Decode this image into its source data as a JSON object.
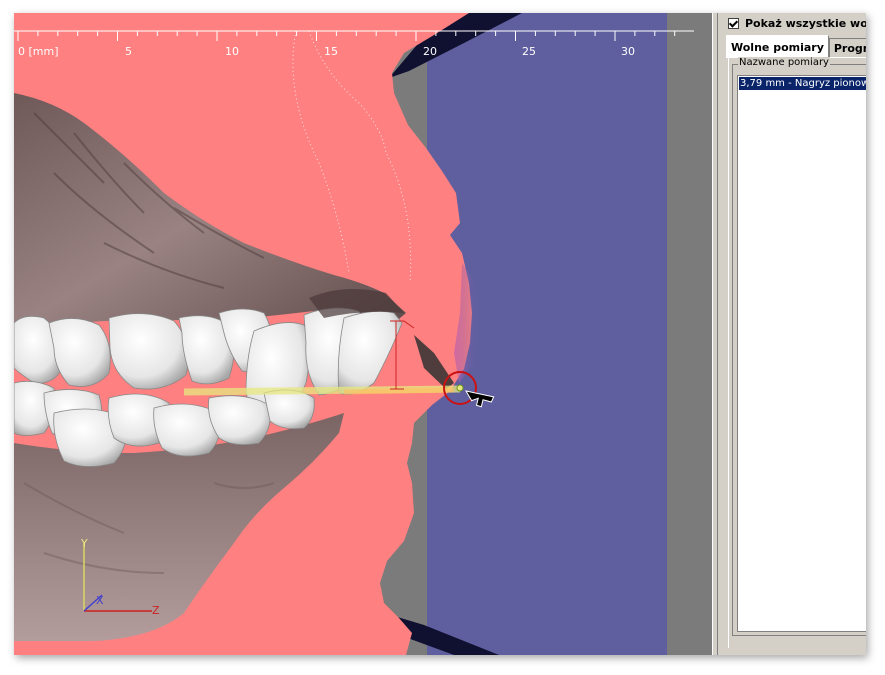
{
  "viewport": {
    "ruler": {
      "unit_label": "0 [mm]",
      "ticks": [
        "5",
        "10",
        "15",
        "20",
        "25",
        "30"
      ]
    },
    "axes": {
      "y": "Y",
      "x": "X",
      "z": "Z"
    },
    "colors": {
      "soft_tissue_plane": "#ff8080",
      "measurement_plane": "#5f5fa0",
      "background": "#7b7b7b",
      "gum": "#8a7272",
      "teeth": "#f2f2f2",
      "measure_line": "#e8e880",
      "vertical_marker": "#cc2222"
    }
  },
  "sidepanel": {
    "show_all_checkbox": {
      "label": "Pokaż wszystkie wolne",
      "checked": true
    },
    "tabs": [
      {
        "label": "Wolne pomiary",
        "active": true
      },
      {
        "label": "Program",
        "active": false
      }
    ],
    "named_group": {
      "title": "Nazwane pomiary",
      "items": [
        "3,79 mm - Nagryz pionow"
      ]
    }
  }
}
